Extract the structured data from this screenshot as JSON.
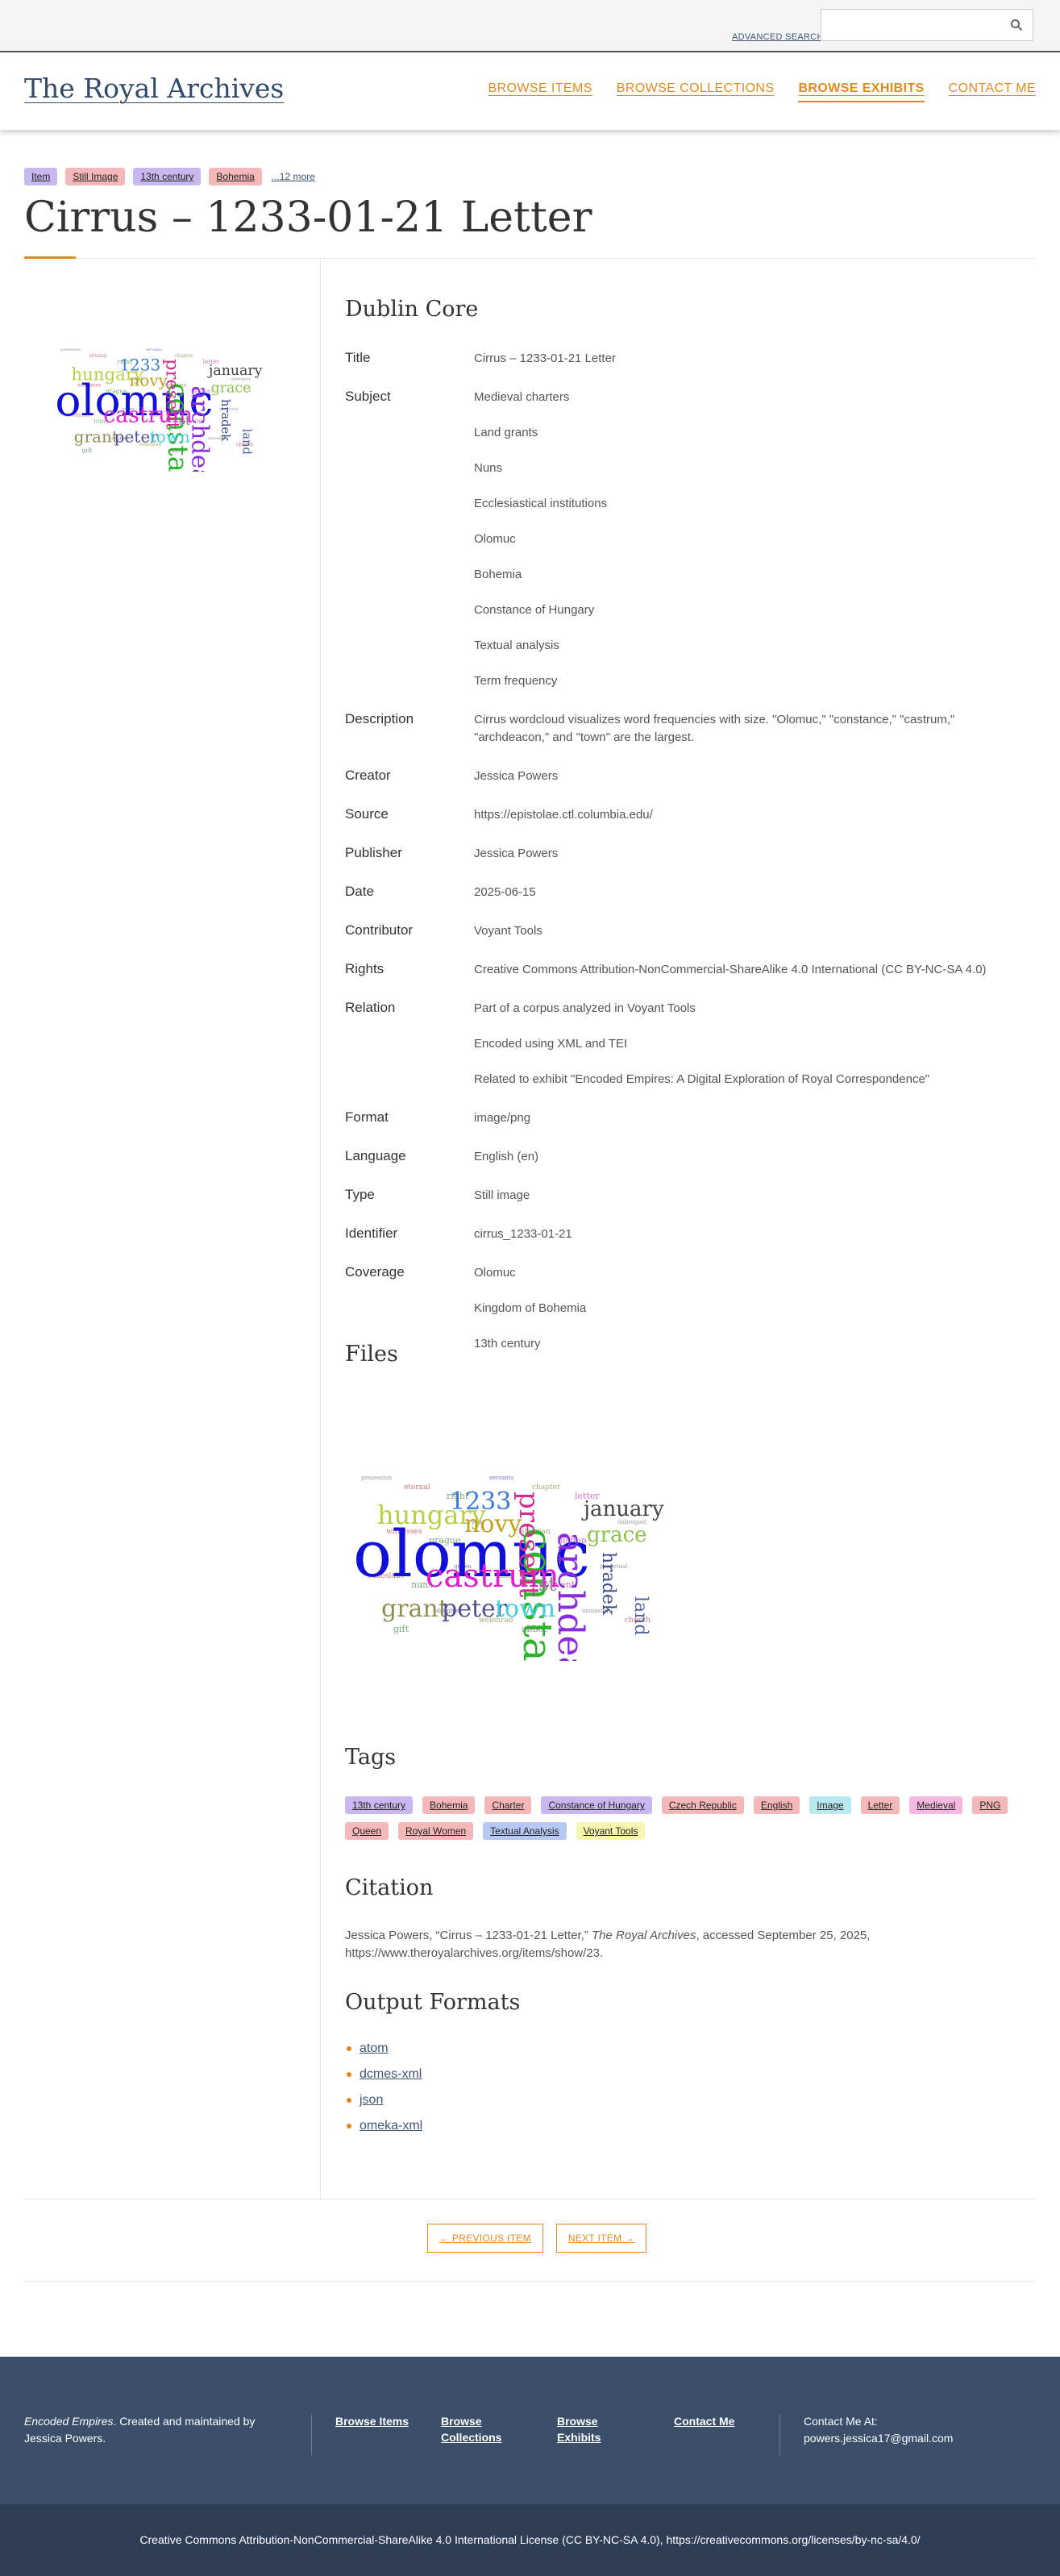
{
  "topbar": {
    "advanced_search": "ADVANCED SEARCH",
    "search_placeholder": ""
  },
  "header": {
    "site_title": "The Royal Archives",
    "nav": [
      "BROWSE ITEMS",
      "BROWSE COLLECTIONS",
      "BROWSE EXHIBITS",
      "CONTACT ME"
    ]
  },
  "top_tags": [
    {
      "label": "Item",
      "color": "#c9b8f0"
    },
    {
      "label": "Still Image",
      "color": "#f5b8b8"
    },
    {
      "label": "13th century",
      "color": "#c9b8f0"
    },
    {
      "label": "Bohemia",
      "color": "#f5b8b8"
    }
  ],
  "top_tags_more": "...12 more",
  "item_title": "Cirrus – 1233-01-21 Letter",
  "dublin_core_heading": "Dublin Core",
  "dublin_core": [
    {
      "label": "Title",
      "values": [
        "Cirrus – 1233-01-21 Letter"
      ]
    },
    {
      "label": "Subject",
      "values": [
        "Medieval charters",
        "Land grants",
        "Nuns",
        "Ecclesiastical institutions",
        "Olomuc",
        "Bohemia",
        "Constance of Hungary",
        "Textual analysis",
        "Term frequency"
      ]
    },
    {
      "label": "Description",
      "values": [
        "Cirrus wordcloud visualizes word frequencies with size. \"Olomuc,\" \"constance,\" \"castrum,\" \"archdeacon,\" and \"town\" are the largest."
      ]
    },
    {
      "label": "Creator",
      "values": [
        "Jessica Powers"
      ]
    },
    {
      "label": "Source",
      "values": [
        "https://epistolae.ctl.columbia.edu/"
      ]
    },
    {
      "label": "Publisher",
      "values": [
        "Jessica Powers"
      ]
    },
    {
      "label": "Date",
      "values": [
        "2025-06-15"
      ]
    },
    {
      "label": "Contributor",
      "values": [
        "Voyant Tools"
      ]
    },
    {
      "label": "Rights",
      "values": [
        "Creative Commons Attribution-NonCommercial-ShareAlike 4.0 International (CC BY-NC-SA 4.0)"
      ]
    },
    {
      "label": "Relation",
      "values": [
        "Part of a corpus analyzed in Voyant Tools",
        "Encoded using XML and TEI",
        "Related to exhibit \"Encoded Empires: A Digital Exploration of Royal Correspondence\""
      ]
    },
    {
      "label": "Format",
      "values": [
        "image/png"
      ]
    },
    {
      "label": "Language",
      "values": [
        "English (en)"
      ]
    },
    {
      "label": "Type",
      "values": [
        "Still image"
      ]
    },
    {
      "label": "Identifier",
      "values": [
        "cirrus_1233-01-21"
      ]
    },
    {
      "label": "Coverage",
      "values": [
        "Olomuc",
        "Kingdom of Bohemia",
        "13th century"
      ]
    }
  ],
  "files_heading": "Files",
  "wordcloud": {
    "big": [
      {
        "t": "olomuc",
        "c": "#1010d8"
      },
      {
        "t": "constance",
        "c": "#2bb52b"
      },
      {
        "t": "archdeacon",
        "c": "#8a2be2"
      },
      {
        "t": "castrum",
        "c": "#e020d0"
      },
      {
        "t": "present",
        "c": "#d03090"
      },
      {
        "t": "hungary",
        "c": "#b8d040"
      },
      {
        "t": "1233",
        "c": "#3a7ad8"
      },
      {
        "t": "novy",
        "c": "#c0a020"
      },
      {
        "t": "january",
        "c": "#444444"
      },
      {
        "t": "grace",
        "c": "#8bc34a"
      },
      {
        "t": "hradek",
        "c": "#3a4a8a"
      },
      {
        "t": "land",
        "c": "#5060a0"
      },
      {
        "t": "st",
        "c": "#888888"
      },
      {
        "t": "grant",
        "c": "#909050"
      },
      {
        "t": "peter",
        "c": "#505090"
      },
      {
        "t": "town",
        "c": "#40d0e0"
      }
    ],
    "small": [
      "possession",
      "eternal",
      "right",
      "servants",
      "chapter",
      "letter",
      "dobrogost",
      "witnesses",
      "prague",
      "year",
      "cistercian",
      "bishop",
      "perpetual",
      "radoslaus",
      "nuns",
      "queen",
      "king",
      "convent",
      "monastery",
      "church",
      "gift",
      "daughter",
      "welehrad",
      "abbot"
    ]
  },
  "tags_heading": "Tags",
  "tags": [
    {
      "label": "13th century",
      "color": "#c9b8f0"
    },
    {
      "label": "Bohemia",
      "color": "#f5b8b8"
    },
    {
      "label": "Charter",
      "color": "#f5b8b8"
    },
    {
      "label": "Constance of Hungary",
      "color": "#c9b8f0"
    },
    {
      "label": "Czech Republic",
      "color": "#f5b8b8"
    },
    {
      "label": "English",
      "color": "#f5b8b8"
    },
    {
      "label": "Image",
      "color": "#b8e8f0"
    },
    {
      "label": "Letter",
      "color": "#f5b8b8"
    },
    {
      "label": "Medieval",
      "color": "#f5b8e0"
    },
    {
      "label": "PNG",
      "color": "#f5b8b8"
    },
    {
      "label": "Queen",
      "color": "#f5b8b8"
    },
    {
      "label": "Royal Women",
      "color": "#f5b8b8"
    },
    {
      "label": "Textual Analysis",
      "color": "#b8c8f5"
    },
    {
      "label": "Voyant Tools",
      "color": "#f8f5b0"
    }
  ],
  "citation_heading": "Citation",
  "citation": {
    "prefix": "Jessica Powers, “Cirrus – 1233-01-21 Letter,” ",
    "site": "The Royal Archives",
    "suffix": ", accessed September 25, 2025, https://www.theroyalarchives.org/items/show/23."
  },
  "formats_heading": "Output Formats",
  "formats": [
    "atom",
    "dcmes-xml",
    "json",
    "omeka-xml"
  ],
  "pager": {
    "prev": "← PREVIOUS ITEM",
    "next": "NEXT ITEM →"
  },
  "footer": {
    "about_em": "Encoded Empires",
    "about_rest": ". Created and maintained by Jessica Powers.",
    "links": [
      "Browse Items",
      "Browse Collections",
      "Browse Exhibits",
      "Contact Me"
    ],
    "contact_label": "Contact Me At:",
    "contact_email": "powers.jessica17@gmail.com",
    "license": "Creative Commons Attribution-NonCommercial-ShareAlike 4.0 International License (CC BY-NC-SA 4.0), https://creativecommons.org/licenses/by-nc-sa/4.0/"
  }
}
